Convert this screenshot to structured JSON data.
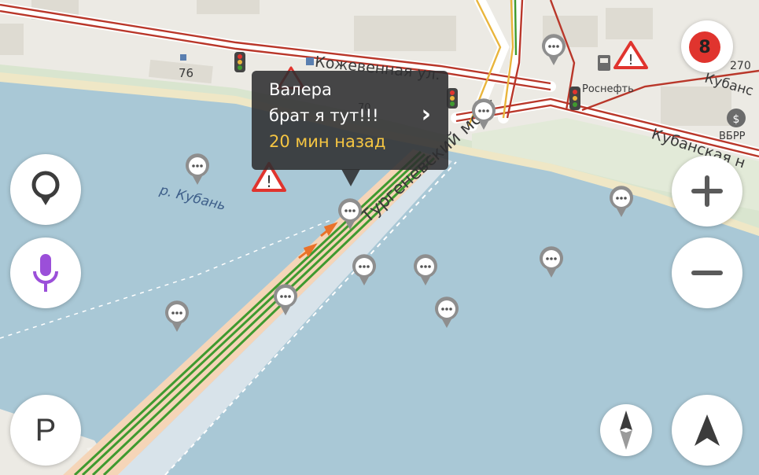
{
  "map": {
    "colors": {
      "water": "#a9c8d6",
      "land": "#eceae4",
      "road": "#ffffff",
      "traffic_red": "#b9372a",
      "traffic_green": "#3f9a2f",
      "traffic_orange": "#e9722a"
    },
    "labels": {
      "street_kozhevennaya": "Кожевенная ул.",
      "bridge": "Тургеневский мост",
      "river": "р. Кубань",
      "street_kubanskaya_top": "Кубанс",
      "street_kubanskaya": "Кубанская н",
      "num_76": "76",
      "num_70": "70",
      "num_270": "270",
      "rosneft": "Роснефть",
      "vbrr": "ВБРР"
    },
    "popup": {
      "name": "Валера",
      "message": "брат я тут!!!",
      "time": "20 мин назад",
      "chevron": "›"
    },
    "notification_count": "8",
    "icons": {
      "search": "search-icon",
      "voice": "microphone-icon",
      "parking": "P",
      "zoom_in": "plus-icon",
      "zoom_out": "minus-icon",
      "compass": "compass-icon",
      "navigate": "navigation-arrow-icon",
      "chat": "chat-bubble-icon",
      "warning": "warning-icon",
      "traffic_light": "traffic-light-icon",
      "fuel": "fuel-station-icon",
      "bank": "bank-icon"
    }
  }
}
